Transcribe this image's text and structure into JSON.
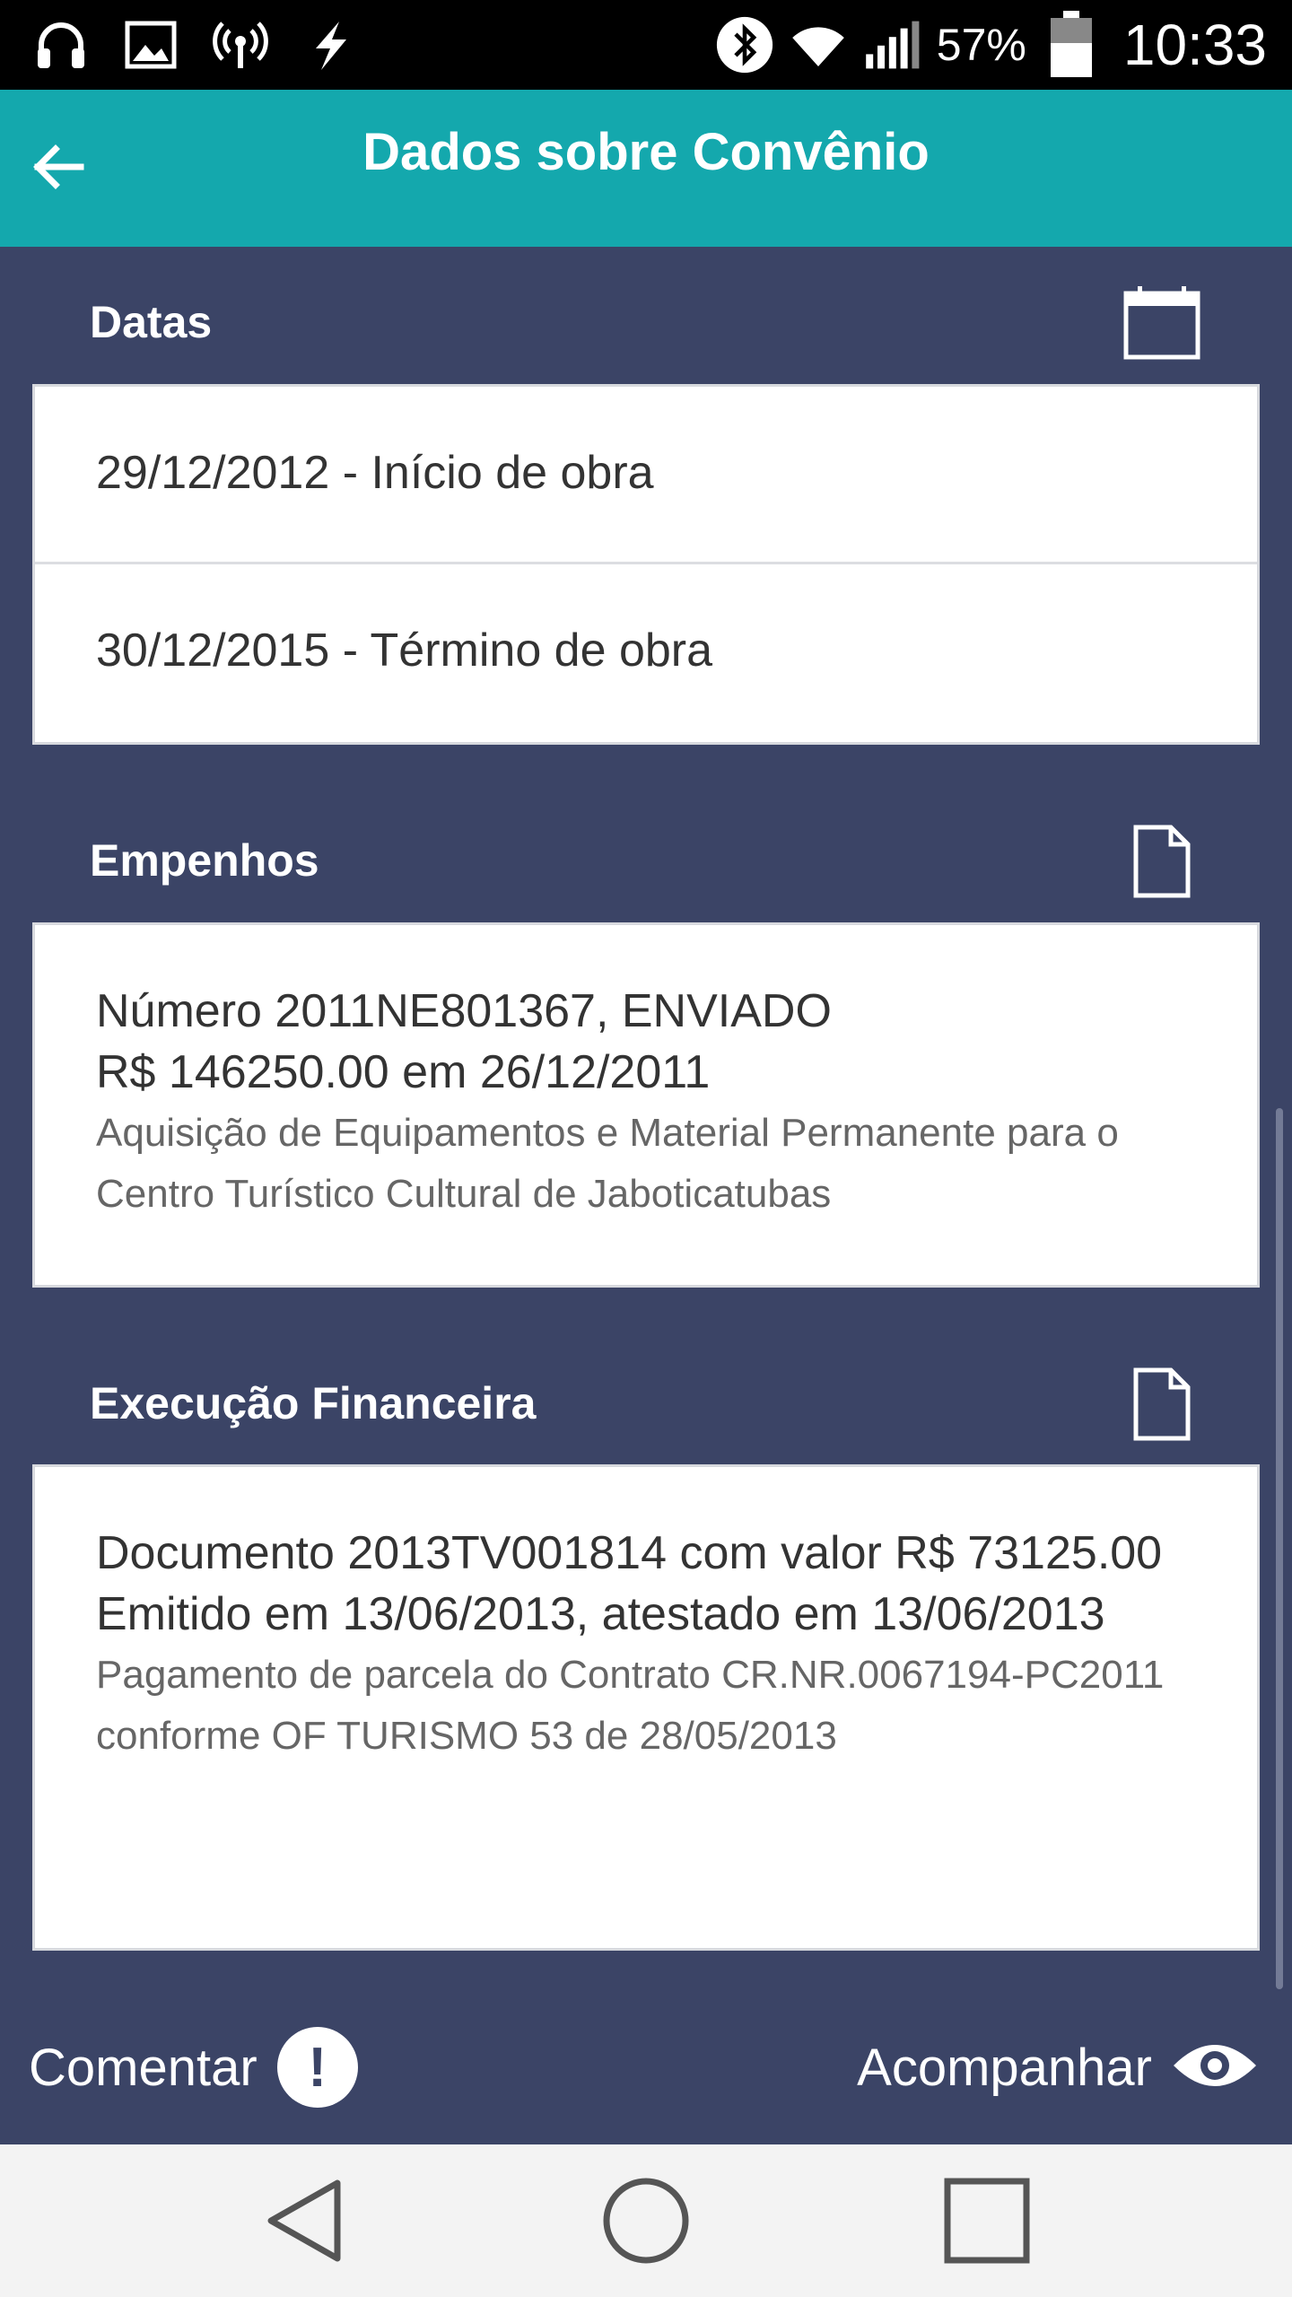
{
  "status_bar": {
    "battery_percent": "57%",
    "time": "10:33",
    "left_icons": [
      "headphones-icon",
      "image-icon",
      "hotspot-icon",
      "flash-icon"
    ],
    "right_icons": [
      "bluetooth-icon",
      "wifi-icon",
      "signal-icon",
      "battery-icon"
    ]
  },
  "app_bar": {
    "title": "Dados sobre Convênio",
    "back_icon": "arrow-left-icon",
    "background": "#14a8ad"
  },
  "sections": {
    "datas": {
      "header": "Datas",
      "icon": "calendar-icon",
      "rows": [
        {
          "text": "29/12/2012 - Início de obra"
        },
        {
          "text": "30/12/2015 - Término de obra"
        }
      ]
    },
    "empenhos": {
      "header": "Empenhos",
      "icon": "document-icon",
      "line1": "Número 2011NE801367, ENVIADO",
      "line2": "R$ 146250.00 em 26/12/2011",
      "description": "Aquisição de Equipamentos e Material Permanente para o Centro Turístico Cultural de Jaboticatubas"
    },
    "execucao": {
      "header": "Execução Financeira",
      "icon": "document-icon",
      "line1": "Documento 2013TV001814 com valor R$ 73125.00",
      "line2": "Emitido em 13/06/2013, atestado em 13/06/2013",
      "description": "Pagamento de parcela do Contrato CR.NR.0067194-PC2011 conforme OF TURISMO 53 de 28/05/2013"
    }
  },
  "actions": {
    "comentar_label": "Comentar",
    "comentar_icon": "alert-icon",
    "acompanhar_label": "Acompanhar",
    "acompanhar_icon": "eye-icon"
  },
  "nav_bar": {
    "buttons": [
      "back-triangle-icon",
      "home-circle-icon",
      "recents-square-icon"
    ]
  },
  "colors": {
    "content_background": "#3b4466",
    "accent": "#14a8ad",
    "card": "#ffffff"
  }
}
